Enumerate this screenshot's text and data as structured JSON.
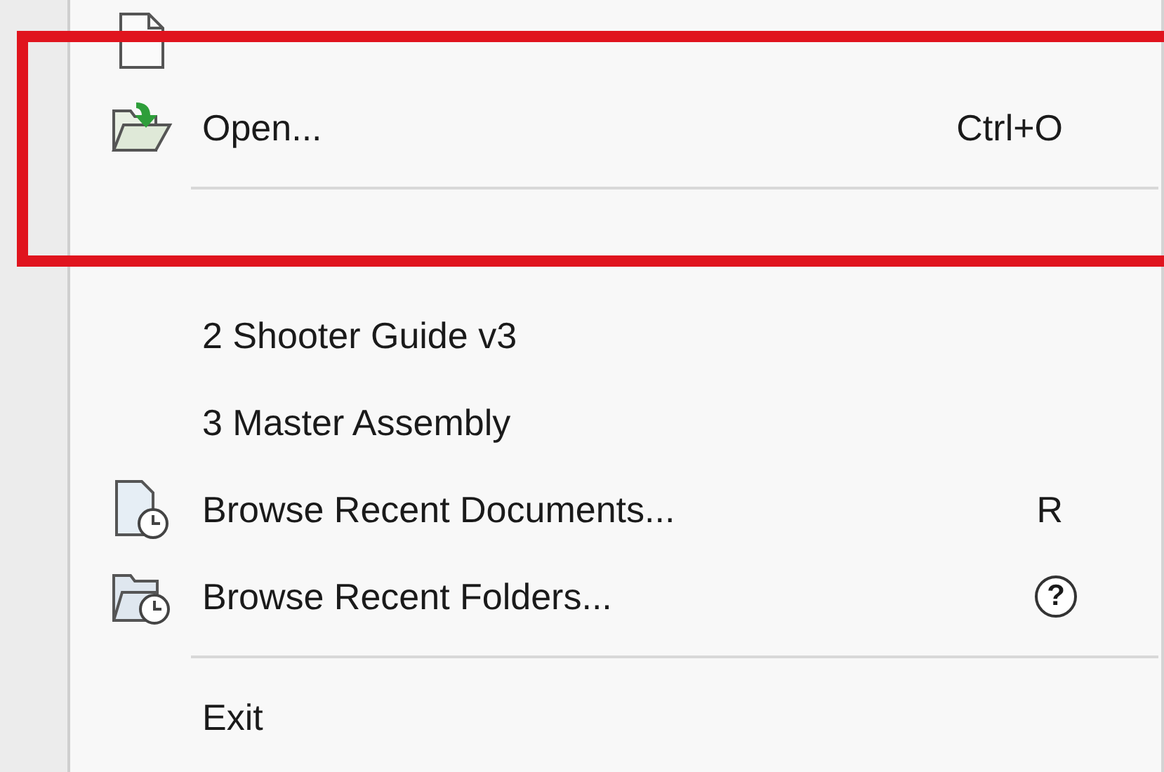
{
  "menu": {
    "items": [
      {
        "kind": "new"
      },
      {
        "kind": "open",
        "label": "Open...",
        "shortcut": "Ctrl+O"
      },
      {
        "kind": "separator"
      },
      {
        "kind": "recent"
      },
      {
        "kind": "recent",
        "label": "2 Shooter Guide v3"
      },
      {
        "kind": "recent",
        "label": "3 Master Assembly"
      },
      {
        "kind": "recent-documents",
        "label": "Browse Recent Documents...",
        "shortcut": "R"
      },
      {
        "kind": "recent-folders",
        "label": "Browse Recent Folders...",
        "hint_mark": "?"
      },
      {
        "kind": "separator"
      },
      {
        "kind": "plain",
        "label": "Exit"
      }
    ]
  }
}
